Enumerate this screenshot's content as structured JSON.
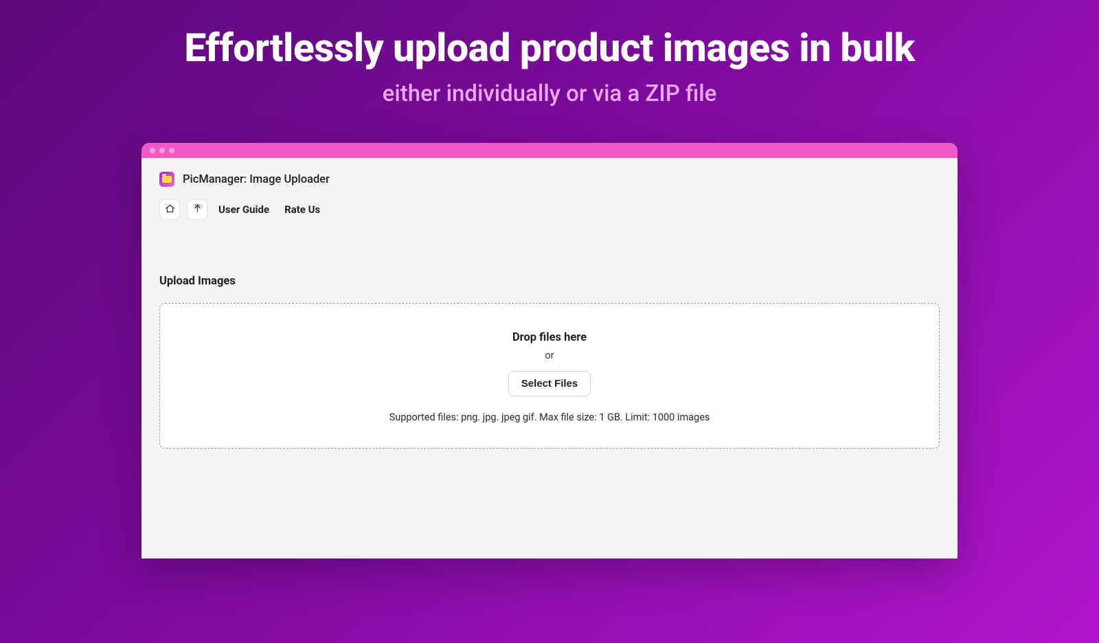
{
  "hero": {
    "title": "Effortlessly upload product images in bulk",
    "subtitle": "either individually or via a ZIP file"
  },
  "app": {
    "title": "PicManager: Image Uploader"
  },
  "toolbar": {
    "user_guide": "User Guide",
    "rate_us": "Rate Us"
  },
  "upload": {
    "section_title": "Upload Images",
    "drop_text": "Drop files here",
    "or_text": "or",
    "select_button": "Select Files",
    "supported_text": "Supported files: png. jpg. jpeg gif. Max file size: 1 GB. Limit: 1000 images"
  }
}
